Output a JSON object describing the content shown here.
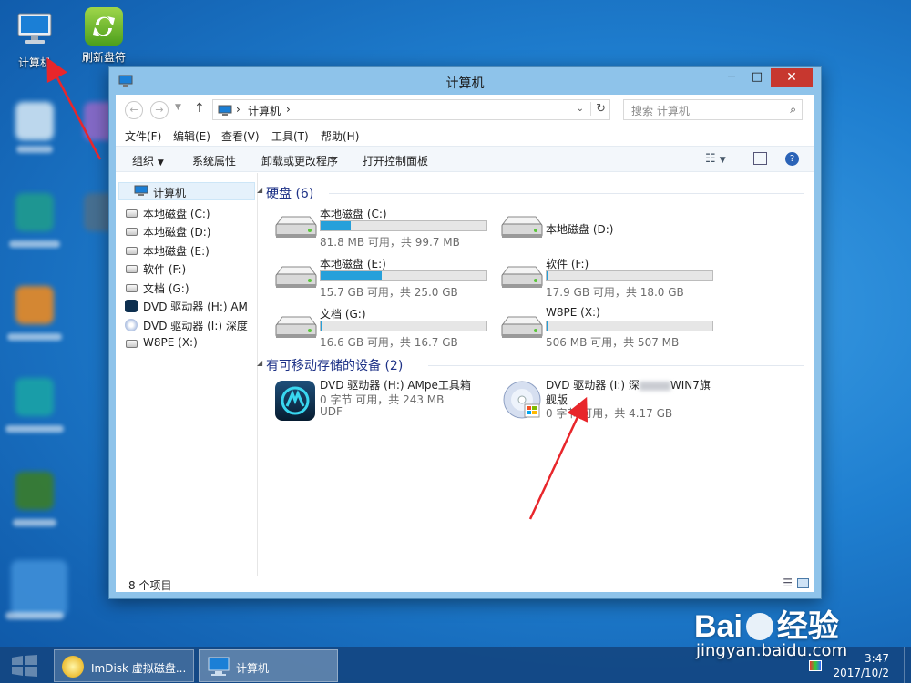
{
  "desktop": {
    "icons": [
      {
        "label": "计算机"
      },
      {
        "label": "刷新盘符"
      }
    ]
  },
  "window": {
    "title": "计算机",
    "controls": {
      "minimize": "─",
      "maximize": "□",
      "close": "✕"
    },
    "address": {
      "path_root": "计算机",
      "separator": "›"
    },
    "search": {
      "placeholder": "搜索 计算机"
    },
    "menu": [
      "文件(F)",
      "编辑(E)",
      "查看(V)",
      "工具(T)",
      "帮助(H)"
    ],
    "toolbar": {
      "organize": "组织",
      "items": [
        "系统属性",
        "卸载或更改程序",
        "打开控制面板"
      ]
    },
    "nav": {
      "root": "计算机",
      "items": [
        "本地磁盘 (C:)",
        "本地磁盘 (D:)",
        "本地磁盘 (E:)",
        "软件 (F:)",
        "文档 (G:)",
        "DVD 驱动器 (H:) AM",
        "DVD 驱动器 (I:) 深度",
        "W8PE (X:)"
      ]
    },
    "groups": {
      "hard_disks": {
        "title": "硬盘 (6)"
      },
      "removable": {
        "title": "有可移动存储的设备 (2)"
      }
    },
    "drives": [
      {
        "name": "本地磁盘 (C:)",
        "info": "81.8 MB 可用，共 99.7 MB",
        "used_pct": 18
      },
      {
        "name": "本地磁盘 (D:)",
        "info": "",
        "used_pct": null
      },
      {
        "name": "本地磁盘 (E:)",
        "info": "15.7 GB 可用，共 25.0 GB",
        "used_pct": 37
      },
      {
        "name": "软件 (F:)",
        "info": "17.9 GB 可用，共 18.0 GB",
        "used_pct": 1
      },
      {
        "name": "文档 (G:)",
        "info": "16.6 GB 可用，共 16.7 GB",
        "used_pct": 1
      },
      {
        "name": "W8PE (X:)",
        "info": "506 MB 可用，共 507 MB",
        "used_pct": 0
      }
    ],
    "removable_drives": [
      {
        "name": "DVD 驱动器 (H:) AMpe工具箱",
        "info": "0 字节 可用，共 243 MB",
        "fs": "UDF"
      },
      {
        "name_a": "DVD 驱动器 (I:) 深",
        "name_b": "WIN7旗",
        "name_c": "舰版",
        "info": "0 字节 可用，共 4.17 GB"
      }
    ],
    "status": {
      "count": "8 个项目"
    }
  },
  "taskbar": {
    "buttons": [
      {
        "label": "ImDisk 虚拟磁盘..."
      },
      {
        "label": "计算机"
      }
    ],
    "clock": {
      "time": "3:47",
      "date": "2017/10/2"
    }
  },
  "watermark": {
    "brand_a": "Bai",
    "brand_b": "经验",
    "url": "jingyan.baidu.com"
  },
  "colors": {
    "accent": "#26a0da",
    "close": "#c7372f",
    "group": "#1e3287"
  }
}
